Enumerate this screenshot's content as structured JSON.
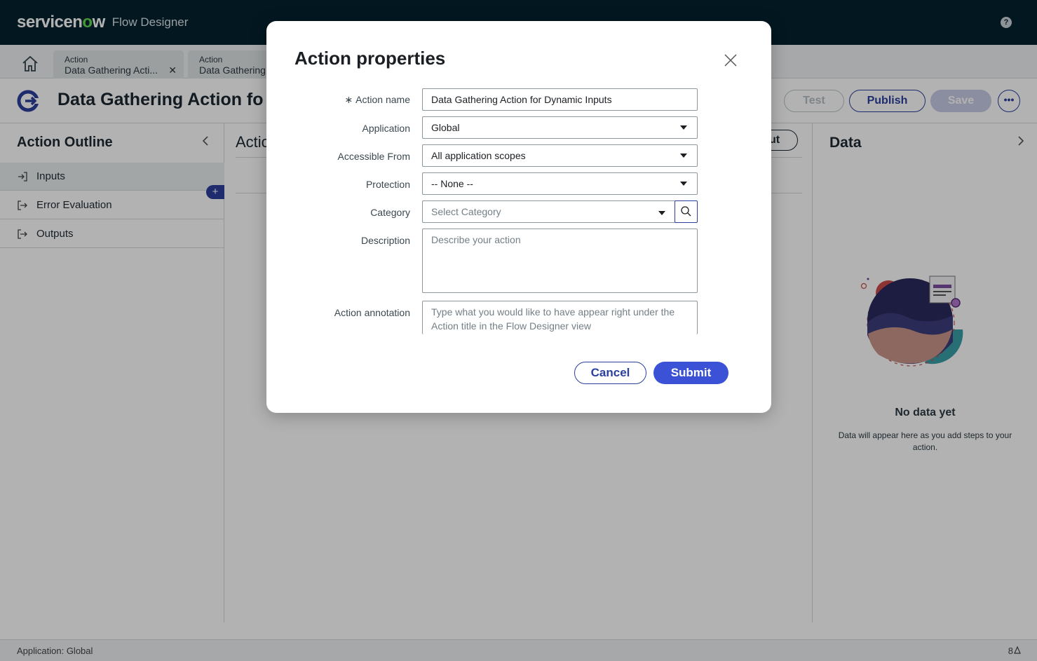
{
  "header": {
    "logo_text_1": "servicen",
    "logo_o": "o",
    "logo_text_2": "w",
    "product": "Flow Designer",
    "help": "?"
  },
  "tabs": [
    {
      "type": "Action",
      "name": "Data Gathering Acti...",
      "close": "✕"
    },
    {
      "type": "Action",
      "name": "Data Gathering"
    }
  ],
  "action_bar": {
    "title": "Data Gathering Action fo",
    "test_label": "Test",
    "publish_label": "Publish",
    "save_label": "Save",
    "more_label": "•••"
  },
  "outline": {
    "title": "Action Outline",
    "items": [
      {
        "label": "Inputs"
      },
      {
        "label": "Error Evaluation"
      },
      {
        "label": "Outputs"
      }
    ],
    "add_label": "+"
  },
  "center": {
    "title": "Actic",
    "pill_label": "ut"
  },
  "data_panel": {
    "title": "Data",
    "empty_title": "No data yet",
    "empty_hint": "Data will appear here as you add steps to your action."
  },
  "footer": {
    "app": "Application: Global",
    "count": "8"
  },
  "modal": {
    "title": "Action properties",
    "fields": {
      "action_name": {
        "label": "Action name",
        "required": "∗",
        "value": "Data Gathering Action for Dynamic Inputs"
      },
      "application": {
        "label": "Application",
        "value": "Global"
      },
      "accessible_from": {
        "label": "Accessible From",
        "value": "All application scopes"
      },
      "protection": {
        "label": "Protection",
        "value": "-- None --"
      },
      "category": {
        "label": "Category",
        "placeholder": "Select Category"
      },
      "description": {
        "label": "Description",
        "placeholder": "Describe your action"
      },
      "annotation": {
        "label": "Action annotation",
        "placeholder": "Type what you would like to have appear right under the Action title in the Flow Designer view"
      }
    },
    "cancel_label": "Cancel",
    "submit_label": "Submit"
  },
  "colors": {
    "header_bg": "#04222e",
    "brand_green": "#62d84e",
    "primary": "#2b3f9e",
    "submit": "#3b51d6"
  }
}
